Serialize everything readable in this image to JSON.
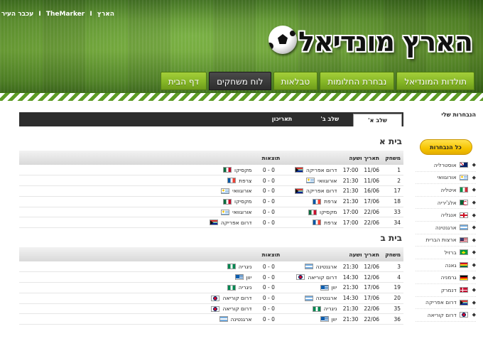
{
  "top_links": {
    "haaretz": "הארץ",
    "themarker": "TheMarker",
    "ir": "עכבר העיר",
    "separator": "I"
  },
  "logo": {
    "text": "הארץ מונדיאל"
  },
  "nav": [
    {
      "label": "דף הבית",
      "active": false
    },
    {
      "label": "לוח משחקים",
      "active": true
    },
    {
      "label": "טבלאות",
      "active": false
    },
    {
      "label": "נבחרת החלומות",
      "active": false
    },
    {
      "label": "תולדות המונדיאל",
      "active": false
    }
  ],
  "sidebar": {
    "title": "הנבחרות שלי",
    "all_button": "כל הנבחרות",
    "teams": [
      {
        "name": "אוסטרליה",
        "flag": "australia"
      },
      {
        "name": "אורוגוואי",
        "flag": "uruguay"
      },
      {
        "name": "איטליה",
        "flag": "italy"
      },
      {
        "name": "אלג'יריה",
        "flag": "algeria"
      },
      {
        "name": "אנגליה",
        "flag": "england"
      },
      {
        "name": "ארגנטינה",
        "flag": "argentina"
      },
      {
        "name": "ארצות הברית",
        "flag": "usa"
      },
      {
        "name": "ברזיל",
        "flag": "brazil"
      },
      {
        "name": "גאנה",
        "flag": "ghana"
      },
      {
        "name": "גרמניה",
        "flag": "germany"
      },
      {
        "name": "דנמרק",
        "flag": "denmark"
      },
      {
        "name": "דרום אפריקה",
        "flag": "southafrica"
      },
      {
        "name": "דרום קוריאה",
        "flag": "korea"
      }
    ]
  },
  "stage_tabs": [
    {
      "label": "שלב א'",
      "active": true
    },
    {
      "label": "שלב ב'",
      "active": false
    },
    {
      "label": "תאריכון",
      "active": false
    }
  ],
  "table_headers": {
    "match": "משחק",
    "datetime": "תאריך ושעה",
    "result": "תוצאות"
  },
  "groups": [
    {
      "title": "בית א",
      "rows": [
        {
          "num": "1",
          "date": "11/06",
          "time": "17:00",
          "home": "דרום אפריקה",
          "home_flag": "southafrica",
          "score": "0 - 0",
          "away": "מקסיקו",
          "away_flag": "mexico"
        },
        {
          "num": "2",
          "date": "11/06",
          "time": "21:30",
          "home": "אורוגוואי",
          "home_flag": "uruguay",
          "score": "0 - 0",
          "away": "צרפת",
          "away_flag": "france"
        },
        {
          "num": "17",
          "date": "16/06",
          "time": "21:30",
          "home": "דרום אפריקה",
          "home_flag": "southafrica",
          "score": "0 - 0",
          "away": "אורוגוואי",
          "away_flag": "uruguay"
        },
        {
          "num": "18",
          "date": "17/06",
          "time": "21:30",
          "home": "צרפת",
          "home_flag": "france",
          "score": "0 - 0",
          "away": "מקסיקו",
          "away_flag": "mexico"
        },
        {
          "num": "33",
          "date": "22/06",
          "time": "17:00",
          "home": "מקסיקו",
          "home_flag": "mexico",
          "score": "0 - 0",
          "away": "אורוגוואי",
          "away_flag": "uruguay"
        },
        {
          "num": "34",
          "date": "22/06",
          "time": "17:00",
          "home": "צרפת",
          "home_flag": "france",
          "score": "0 - 0",
          "away": "דרום אפריקה",
          "away_flag": "southafrica"
        }
      ]
    },
    {
      "title": "בית ב",
      "rows": [
        {
          "num": "3",
          "date": "12/06",
          "time": "21:30",
          "home": "ארגנטינה",
          "home_flag": "argentina",
          "score": "0 - 0",
          "away": "ניגריה",
          "away_flag": "nigeria"
        },
        {
          "num": "4",
          "date": "12/06",
          "time": "14:30",
          "home": "דרום קוריאה",
          "home_flag": "korea",
          "score": "0 - 0",
          "away": "יוון",
          "away_flag": "greece"
        },
        {
          "num": "19",
          "date": "17/06",
          "time": "21:30",
          "home": "יוון",
          "home_flag": "greece",
          "score": "0 - 0",
          "away": "ניגריה",
          "away_flag": "nigeria"
        },
        {
          "num": "20",
          "date": "17/06",
          "time": "14:30",
          "home": "ארגנטינה",
          "home_flag": "argentina",
          "score": "0 - 0",
          "away": "דרום קוריאה",
          "away_flag": "korea"
        },
        {
          "num": "35",
          "date": "22/06",
          "time": "21:30",
          "home": "ניגריה",
          "home_flag": "nigeria",
          "score": "0 - 0",
          "away": "דרום קוריאה",
          "away_flag": "korea"
        },
        {
          "num": "36",
          "date": "22/06",
          "time": "21:30",
          "home": "יוון",
          "home_flag": "greece",
          "score": "0 - 0",
          "away": "ארגנטינה",
          "away_flag": "argentina"
        }
      ]
    }
  ]
}
